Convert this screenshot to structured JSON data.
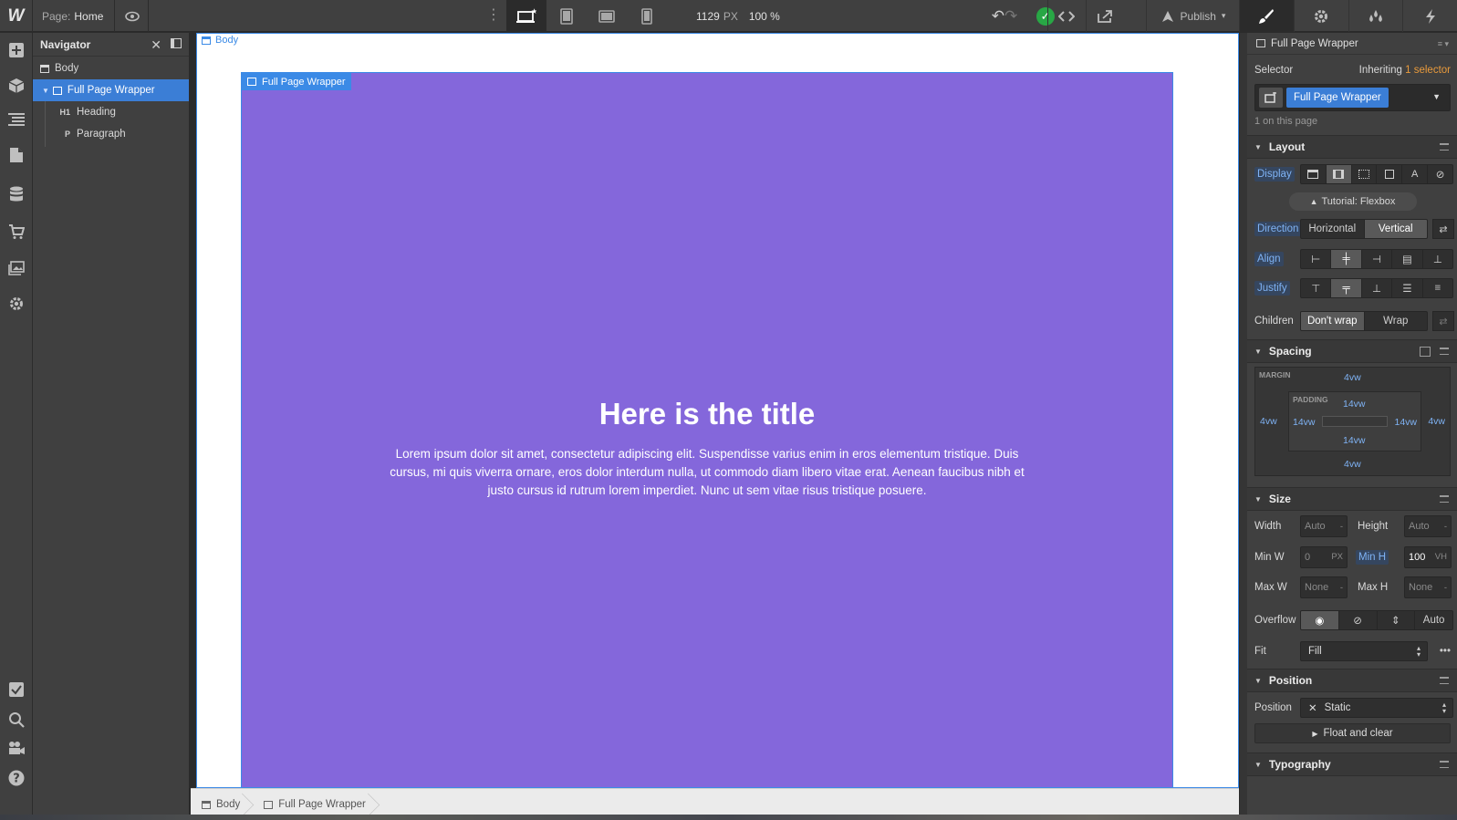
{
  "topbar": {
    "logo": "W",
    "page_label": "Page:",
    "page_name": "Home",
    "canvas_width": "1129",
    "canvas_unit": "PX",
    "zoom": "100 %",
    "publish_label": "Publish"
  },
  "navigator": {
    "title": "Navigator",
    "items": [
      {
        "label": "Body",
        "icon": "body-icon"
      },
      {
        "label": "Full Page Wrapper",
        "icon": "div-block-icon"
      },
      {
        "label": "Heading",
        "icon": "heading-icon",
        "glyph": "H1"
      },
      {
        "label": "Paragraph",
        "icon": "paragraph-icon",
        "glyph": "P"
      }
    ]
  },
  "canvas": {
    "body_tag": "Body",
    "wrapper_tag": "Full Page Wrapper",
    "wrapper_color": "#8467db",
    "title": "Here is the title",
    "paragraph": "Lorem ipsum dolor sit amet, consectetur adipiscing elit. Suspendisse varius enim in eros elementum tristique. Duis cursus, mi quis viverra ornare, eros dolor interdum nulla, ut commodo diam libero vitae erat. Aenean faucibus nibh et justo cursus id rutrum lorem imperdiet. Nunc ut sem vitae risus tristique posuere."
  },
  "breadcrumb": [
    "Body",
    "Full Page Wrapper"
  ],
  "style_panel": {
    "element_name": "Full Page Wrapper",
    "selector_label": "Selector",
    "inheriting_prefix": "Inheriting",
    "inheriting_count": "1 selector",
    "selector_chip": "Full Page Wrapper",
    "on_page": "1 on this page",
    "layout": {
      "title": "Layout",
      "display_label": "Display",
      "tutorial": "Tutorial: Flexbox",
      "direction_label": "Direction",
      "direction_options": [
        "Horizontal",
        "Vertical"
      ],
      "align_label": "Align",
      "justify_label": "Justify",
      "children_label": "Children",
      "children_options": [
        "Don't wrap",
        "Wrap"
      ]
    },
    "spacing": {
      "title": "Spacing",
      "margin_caption": "MARGIN",
      "padding_caption": "PADDING",
      "margin_top": "4vw",
      "margin_right": "4vw",
      "margin_bottom": "4vw",
      "margin_left": "4vw",
      "padding_top": "14vw",
      "padding_right": "14vw",
      "padding_bottom": "14vw",
      "padding_left": "14vw"
    },
    "size": {
      "title": "Size",
      "width_label": "Width",
      "width_value": "Auto",
      "width_unit": "-",
      "height_label": "Height",
      "height_value": "Auto",
      "height_unit": "-",
      "minw_label": "Min W",
      "minw_value": "0",
      "minw_unit": "PX",
      "minh_label": "Min H",
      "minh_value": "100",
      "minh_unit": "VH",
      "maxw_label": "Max W",
      "maxw_value": "None",
      "maxw_unit": "-",
      "maxh_label": "Max H",
      "maxh_value": "None",
      "maxh_unit": "-",
      "overflow_label": "Overflow",
      "overflow_auto": "Auto",
      "fit_label": "Fit",
      "fit_value": "Fill"
    },
    "position": {
      "title": "Position",
      "position_label": "Position",
      "position_value": "Static",
      "float_clear": "Float and clear"
    },
    "typography": {
      "title": "Typography"
    }
  }
}
